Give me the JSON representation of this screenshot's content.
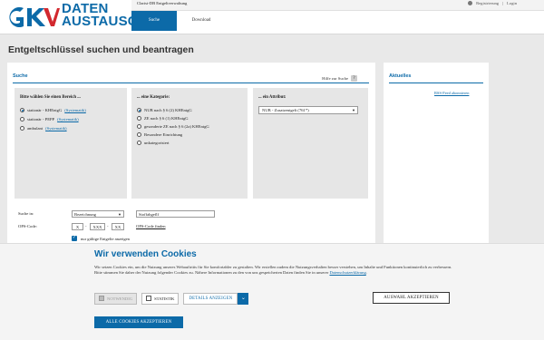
{
  "header": {
    "logo_line1": "DATEN",
    "logo_line2": "AUSTAUSCH",
    "app_title": "Clarist-DB Entgeltverwaltung",
    "registration": "Registrierung",
    "login": "Login",
    "nav": [
      "Suche",
      "Download"
    ],
    "brand_color": "#0c6aa8",
    "logo_red": "#d2282e"
  },
  "page": {
    "title": "Entgeltschlüssel suchen und beantragen"
  },
  "search": {
    "heading": "Suche",
    "help_label": "Hilfe zur Suche",
    "help_icon": "help-icon",
    "panel1": {
      "title": "Bitte wählen Sie einen Bereich ...",
      "options": [
        {
          "label": "stationär - KHEntgG",
          "link": "(Systematik)",
          "selected": true
        },
        {
          "label": "stationär - PEPP",
          "link": "(Systematik)",
          "selected": false
        },
        {
          "label": "ambulant",
          "link": "(Systematik)",
          "selected": false
        }
      ]
    },
    "panel2": {
      "title": "... eine Kategorie:",
      "options": [
        {
          "label": "NUB nach § 6 (2) KHEntgG",
          "selected": true
        },
        {
          "label": "ZE nach § 6 (1) KHEntgG",
          "selected": false
        },
        {
          "label": "gesonderte ZE nach § 6 (2a) KHEntgG",
          "selected": false
        },
        {
          "label": "Besondere Einrichtung",
          "selected": false
        },
        {
          "label": "unkategorisiert",
          "selected": false
        }
      ]
    },
    "panel3": {
      "title": "... ein Attribut:",
      "select_value": "NUB - Zusatzentgelt (761*)"
    },
    "search_in_label": "Suche in:",
    "search_in_value": "Bezeichnung",
    "search_text_value": "Stoffabgeflf",
    "ops_label": "OPS-Code:",
    "ops_parts": [
      "X",
      "XXX",
      "XX"
    ],
    "ops_sep": "-",
    "ops_link": "OPS-Code finden",
    "valid_only_label": "nur gültige Entgelte anzeigen",
    "valid_only_checked": true
  },
  "news": {
    "heading": "Aktuelles",
    "rss_link": "RSS-Feed abonnieren"
  },
  "cookie": {
    "title": "Wir verwenden Cookies",
    "text_before_link": "Wir setzen Cookies ein, um die Nutzung unseres Webauftritts für Sie komfortabler zu gestalten. Wir erstellen zudem die Nutzungsverhalten besser verstehen, um Inhalte und Funktionen kontinuierlich zu verbessern. Bitte stimmen Sie daher der Nutzung folgender Cookies zu. Nähere Informationen zu den von uns gespeicherten Daten finden Sie in unserer ",
    "privacy_link": "Datenschutzerklärung",
    "text_after_link": ".",
    "opt_necessary": "NOTWENDIG",
    "opt_statistics": "STATISTIK",
    "details_label": "DETAILS ANZEIGEN",
    "select_button": "AUSWAHL AKZEPTIEREN",
    "accept_all_button": "ALLE COOKIES AKZEPTIEREN"
  }
}
